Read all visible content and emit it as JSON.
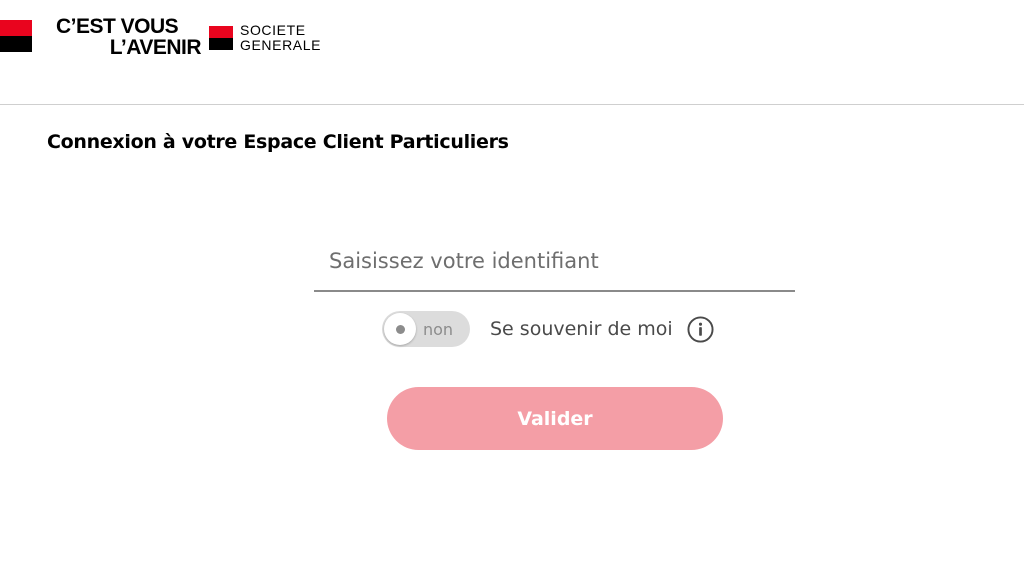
{
  "header": {
    "tagline_line1": "C’EST VOUS",
    "tagline_line2": "L’AVENIR",
    "brand_line1": "SOCIETE",
    "brand_line2": "GENERALE"
  },
  "page": {
    "title": "Connexion à votre Espace Client Particuliers"
  },
  "login_form": {
    "identifier_placeholder": "Saisissez votre identifiant",
    "identifier_value": "",
    "remember_toggle_state": "non",
    "remember_label": "Se souvenir de moi",
    "info_icon": "info-icon",
    "submit_label": "Valider"
  },
  "colors": {
    "brand_red": "#e9041e",
    "brand_black": "#000000",
    "button_disabled": "#f49ea6",
    "toggle_off": "#dcdcdc"
  }
}
